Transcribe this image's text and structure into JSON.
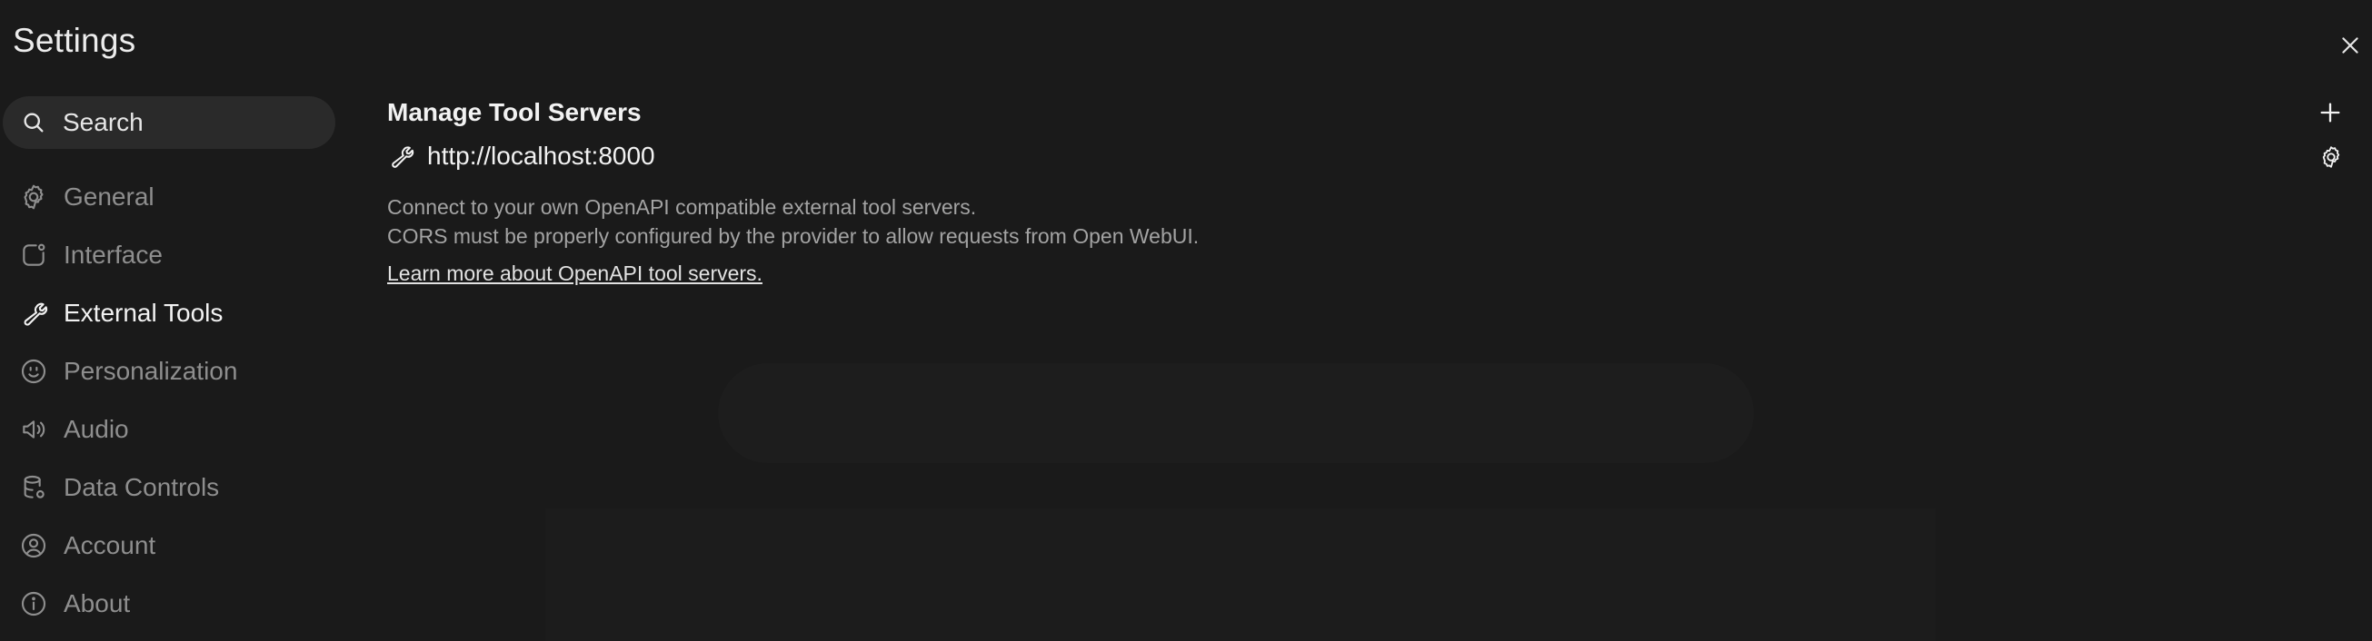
{
  "window": {
    "title": "Settings",
    "close_icon": "close-icon"
  },
  "search": {
    "placeholder": "Search",
    "icon": "search-icon"
  },
  "sidebar": {
    "items": [
      {
        "label": "General",
        "icon": "gear-icon",
        "active": false
      },
      {
        "label": "Interface",
        "icon": "interface-icon",
        "active": false
      },
      {
        "label": "External Tools",
        "icon": "wrench-icon",
        "active": true
      },
      {
        "label": "Personalization",
        "icon": "face-icon",
        "active": false
      },
      {
        "label": "Audio",
        "icon": "speaker-icon",
        "active": false
      },
      {
        "label": "Data Controls",
        "icon": "database-icon",
        "active": false
      },
      {
        "label": "Account",
        "icon": "user-circle-icon",
        "active": false
      },
      {
        "label": "About",
        "icon": "info-icon",
        "active": false
      }
    ]
  },
  "main": {
    "section_title": "Manage Tool Servers",
    "add_icon": "plus-icon",
    "servers": [
      {
        "url": "http://localhost:8000",
        "icon": "wrench-icon",
        "settings_icon": "gear-icon"
      }
    ],
    "description_line1": "Connect to your own OpenAPI compatible external tool servers.",
    "description_line2": "CORS must be properly configured by the provider to allow requests from Open WebUI.",
    "learn_more": "Learn more about OpenAPI tool servers."
  },
  "colors": {
    "background": "#1a1a1a",
    "search_bg": "#2a2a2a",
    "active_text": "#f2f2f2",
    "inactive_text": "#8e8e8e",
    "description_text": "#a3a3a3"
  }
}
